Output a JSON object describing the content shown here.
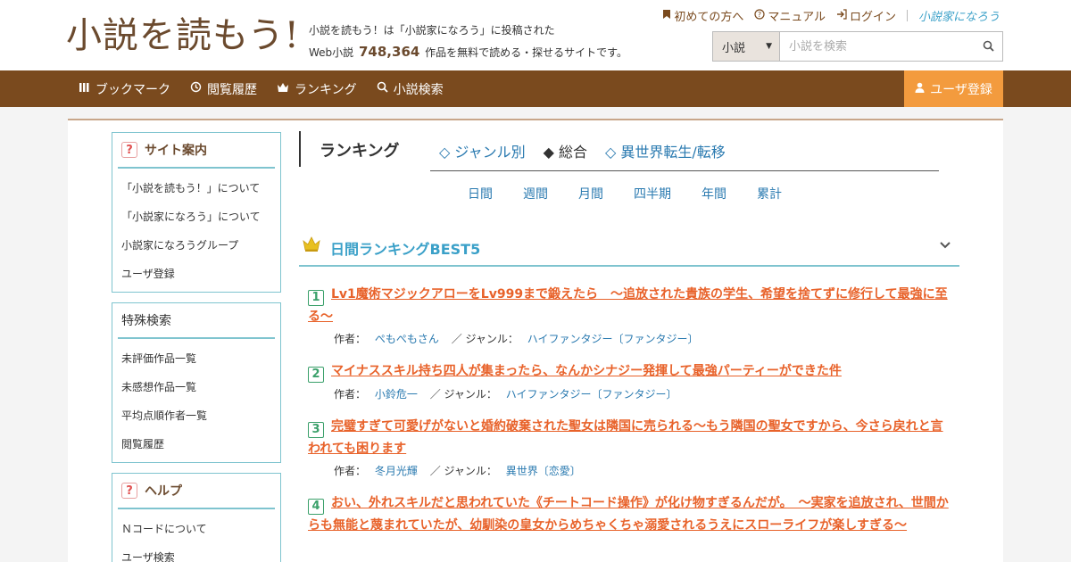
{
  "header": {
    "logo": "小説を読もう!",
    "tagline_line1": "小説を読もう！は「小説家になろう」に投稿された",
    "tagline_pre": "Web小説",
    "tagline_count": "748,364",
    "tagline_post": "作品を無料で読める・探せるサイトです。",
    "toplinks": [
      {
        "icon": "bookmark-icon",
        "label": "初めての方へ"
      },
      {
        "icon": "question-circle-icon",
        "label": "マニュアル"
      },
      {
        "icon": "login-icon",
        "label": "ログイン"
      }
    ],
    "brand": "小説家になろう",
    "search": {
      "select_value": "小説",
      "placeholder": "小説を検索"
    }
  },
  "nav": {
    "items": [
      {
        "icon": "books-icon",
        "label": "ブックマーク"
      },
      {
        "icon": "history-icon",
        "label": "閲覧履歴"
      },
      {
        "icon": "crown-icon",
        "label": "ランキング"
      },
      {
        "icon": "search-icon",
        "label": "小説検索"
      }
    ],
    "register": "ユーザ登録"
  },
  "sidebar": {
    "site_guide": {
      "title": "サイト案内",
      "items": [
        "「小説を読もう！」について",
        "「小説家になろう」について",
        "小説家になろうグループ",
        "ユーザ登録"
      ]
    },
    "special_search": {
      "title": "特殊検索",
      "items": [
        "未評価作品一覧",
        "未感想作品一覧",
        "平均点順作者一覧",
        "閲覧履歴"
      ]
    },
    "help": {
      "title": "ヘルプ",
      "items": [
        "Ｎコードについて",
        "ユーザ検索"
      ]
    }
  },
  "ranking": {
    "title": "ランキング",
    "tabs": [
      "◇ ジャンル別",
      "◆ 総合",
      "◇ 異世界転生/転移"
    ],
    "periods": [
      "日間",
      "週間",
      "月間",
      "四半期",
      "年間",
      "累計"
    ],
    "best_title": "日間ランキングBEST5",
    "author_label": "作者：",
    "genre_label": "／ ジャンル：",
    "entries": [
      {
        "rank": "1",
        "title": "Lv1魔術マジックアローをLv999まで鍛えたら　～追放された貴族の学生、希望を捨てずに修行して最強に至る～",
        "author": "ぺもぺもさん",
        "genre": "ハイファンタジー〔ファンタジー〕"
      },
      {
        "rank": "2",
        "title": "マイナススキル持ち四人が集まったら、なんかシナジー発揮して最強パーティーができた件",
        "author": "小鈴危一",
        "genre": "ハイファンタジー〔ファンタジー〕"
      },
      {
        "rank": "3",
        "title": "完璧すぎて可愛げがないと婚約破棄された聖女は隣国に売られる～もう隣国の聖女ですから、今さら戻れと言われても困ります",
        "author": "冬月光輝",
        "genre": "異世界〔恋愛〕"
      },
      {
        "rank": "4",
        "title": "おい、外れスキルだと思われていた《チートコード操作》が化け物すぎるんだが。　～実家を追放され、世間からも無能と蔑まれていたが、幼馴染の皇女からめちゃくちゃ溺愛されるうえにスローライフが楽しすぎる～",
        "author": "",
        "genre": ""
      }
    ]
  }
}
